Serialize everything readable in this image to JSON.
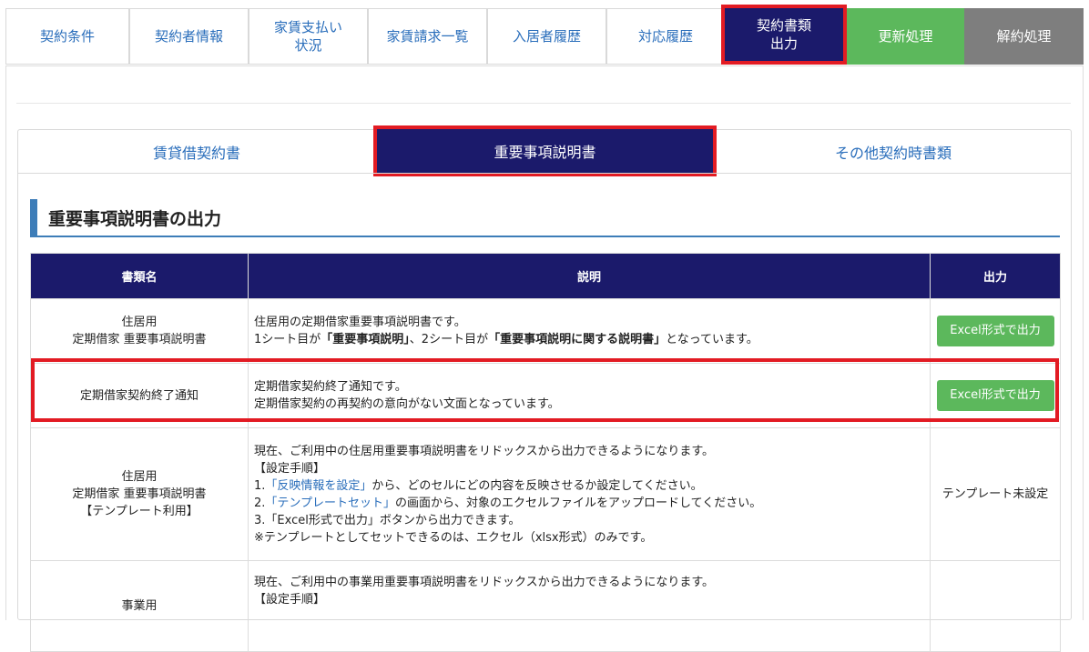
{
  "tabs": [
    {
      "label": "契約条件"
    },
    {
      "label": "契約者情報"
    },
    {
      "label": "家賃支払い\n状況"
    },
    {
      "label": "家賃請求一覧"
    },
    {
      "label": "入居者履歴"
    },
    {
      "label": "対応履歴"
    },
    {
      "label": "契約書類\n出力"
    },
    {
      "label": "更新処理"
    },
    {
      "label": "解約処理"
    }
  ],
  "subtabs": [
    {
      "label": "賃貸借契約書"
    },
    {
      "label": "重要事項説明書"
    },
    {
      "label": "その他契約時書類"
    }
  ],
  "section": {
    "title": "重要事項説明書の出力"
  },
  "table": {
    "headers": [
      "書類名",
      "説明",
      "出力"
    ],
    "rows": [
      {
        "name": [
          "住居用",
          "定期借家 重要事項説明書"
        ],
        "desc": [
          "住居用の定期借家重要事項説明書です。"
        ],
        "desc2_pre": "1シート目が",
        "desc2_b1": "「重要事項説明」",
        "desc2_mid": "、2シート目が",
        "desc2_b2": "「重要事項説明に関する説明書」",
        "desc2_post": "となっています。",
        "button": "Excel形式で出力"
      },
      {
        "name": [
          "定期借家契約終了通知"
        ],
        "desc": [
          "定期借家契約終了通知です。",
          "定期借家契約の再契約の意向がない文面となっています。"
        ],
        "button": "Excel形式で出力"
      },
      {
        "name": [
          "住居用",
          "定期借家 重要事項説明書",
          "【テンプレート利用】"
        ],
        "desc1": "現在、ご利用中の住居用重要事項説明書をリドックスから出力できるようになります。",
        "desc2": "【設定手順】",
        "step1_pre": "1.",
        "step1_link": "「反映情報を設定」",
        "step1_post": "から、どのセルにどの内容を反映させるか設定してください。",
        "step2_pre": "2.",
        "step2_link": "「テンプレートセット」",
        "step2_post": "の画面から、対象のエクセルファイルをアップロードしてください。",
        "step3": "3.「Excel形式で出力」ボタンから出力できます。",
        "note": "※テンプレートとしてセットできるのは、エクセル（xlsx形式）のみです。",
        "status": "テンプレート未設定"
      },
      {
        "name": [
          "事業用"
        ],
        "desc1": "現在、ご利用中の事業用重要事項説明書をリドックスから出力できるようになります。",
        "desc2": "【設定手順】"
      }
    ]
  }
}
